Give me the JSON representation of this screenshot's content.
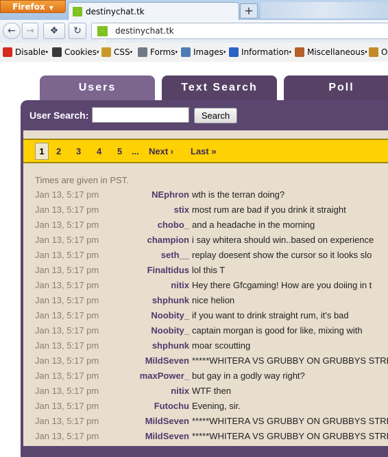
{
  "browser": {
    "menu_button": "Firefox",
    "tab_title": "destinychat.tk",
    "favicon_text": "-=tk",
    "url": "destinychat.tk",
    "new_tab": "+"
  },
  "devbar": {
    "items": [
      {
        "label": "Disable",
        "icon": "disable-icon",
        "color": "#d32b1e"
      },
      {
        "label": "Cookies",
        "icon": "cookies-icon",
        "color": "#3a3a3a"
      },
      {
        "label": "CSS",
        "icon": "css-icon",
        "color": "#c89a2a"
      },
      {
        "label": "Forms",
        "icon": "forms-icon",
        "color": "#6f7a85"
      },
      {
        "label": "Images",
        "icon": "images-icon",
        "color": "#4f7bb3"
      },
      {
        "label": "Information",
        "icon": "information-icon",
        "color": "#2a63c4"
      },
      {
        "label": "Miscellaneous",
        "icon": "miscellaneous-icon",
        "color": "#b55f2b"
      },
      {
        "label": "O",
        "icon": "outline-icon",
        "color": "#c48b2a"
      }
    ]
  },
  "tabs": [
    "Users",
    "Text Search",
    "Poll"
  ],
  "search": {
    "label": "User Search:",
    "value": "",
    "button": "Search"
  },
  "pager": {
    "pages": [
      "1",
      "2",
      "3",
      "4",
      "5"
    ],
    "ellipsis": "...",
    "next": "Next ›",
    "last": "Last »",
    "current": "1"
  },
  "note": "Times are given in PST.",
  "colors": {
    "tab": "#574266",
    "tab_active": "#7c6690",
    "panel": "#5b4670",
    "pager": "#fed103",
    "content": "#e7dece",
    "name": "#4f3b6b"
  },
  "messages": [
    {
      "time": "Jan 13, 5:17 pm",
      "user": "NEphron",
      "text": "wth is the terran doing?"
    },
    {
      "time": "Jan 13, 5:17 pm",
      "user": "stix",
      "text": "most rum are bad if you drink it straight"
    },
    {
      "time": "Jan 13, 5:17 pm",
      "user": "chobo_",
      "text": "and a headache in the morning"
    },
    {
      "time": "Jan 13, 5:17 pm",
      "user": "champion",
      "text": "i say whitera should win..based on experience"
    },
    {
      "time": "Jan 13, 5:17 pm",
      "user": "seth__",
      "text": "replay doesent show the cursor so it looks slo"
    },
    {
      "time": "Jan 13, 5:17 pm",
      "user": "Finaltidus",
      "text": "lol this T"
    },
    {
      "time": "Jan 13, 5:17 pm",
      "user": "nitix",
      "text": "Hey there Gfcgaming! How are you doiing in t"
    },
    {
      "time": "Jan 13, 5:17 pm",
      "user": "shphunk",
      "text": "nice helion"
    },
    {
      "time": "Jan 13, 5:17 pm",
      "user": "Noobity_",
      "text": "if you want to drink straight rum, it's bad"
    },
    {
      "time": "Jan 13, 5:17 pm",
      "user": "Noobity_",
      "text": "captain morgan is good for like, mixing with"
    },
    {
      "time": "Jan 13, 5:17 pm",
      "user": "shphunk",
      "text": "moar scoutting"
    },
    {
      "time": "Jan 13, 5:17 pm",
      "user": "MildSeven",
      "text": "*****WHITERA VS GRUBBY ON GRUBBYS STREA"
    },
    {
      "time": "Jan 13, 5:17 pm",
      "user": "maxPower_",
      "text": "but gay in a godly way right?"
    },
    {
      "time": "Jan 13, 5:17 pm",
      "user": "nitix",
      "text": "WTF then"
    },
    {
      "time": "Jan 13, 5:17 pm",
      "user": "Futochu",
      "text": "Evening, sir."
    },
    {
      "time": "Jan 13, 5:17 pm",
      "user": "MildSeven",
      "text": "*****WHITERA VS GRUBBY ON GRUBBYS STREA"
    },
    {
      "time": "Jan 13, 5:17 pm",
      "user": "MildSeven",
      "text": "*****WHITERA VS GRUBBY ON GRUBBYS STREA"
    }
  ]
}
